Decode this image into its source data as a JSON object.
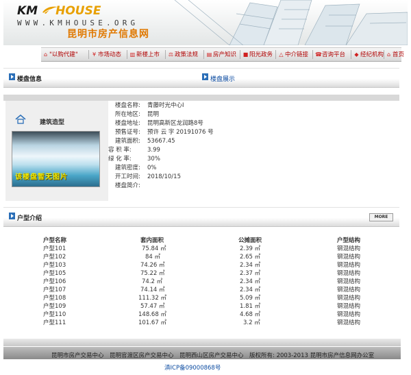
{
  "header": {
    "logo_km": "KM",
    "logo_house": "HOUSE",
    "url": "WWW.KMHOUSE.ORG",
    "site_name": "昆明市房产信息网"
  },
  "nav": {
    "items": [
      {
        "label": "\"以购代建\"",
        "icon": "house-icon"
      },
      {
        "label": "市场动态",
        "icon": "yuan-icon"
      },
      {
        "label": "新楼上市",
        "icon": "building-icon"
      },
      {
        "label": "政策法规",
        "icon": "scale-icon"
      },
      {
        "label": "房产知识",
        "icon": "book-icon"
      },
      {
        "label": "阳光政务",
        "icon": "sun-icon"
      },
      {
        "label": "中介链接",
        "icon": "link-icon"
      },
      {
        "label": "咨询平台",
        "icon": "phone-icon"
      },
      {
        "label": "经纪机构",
        "icon": "agency-icon"
      },
      {
        "label": "首页",
        "icon": "home-icon"
      }
    ]
  },
  "sections": {
    "info_title": "楼盘信息",
    "display_title": "楼盘展示",
    "unit_title": "户型介绍",
    "more": "MORE"
  },
  "building": {
    "label": "建筑造型",
    "photo_caption": "该楼盘暂无图片",
    "fields": [
      {
        "label": "楼盘名称:",
        "value": "青藤时光中心I"
      },
      {
        "label": "所在地区:",
        "value": "昆明"
      },
      {
        "label": "楼盘地址:",
        "value": "昆明高新区龙润路8号"
      },
      {
        "label": "预售证号:",
        "value": "预许 云 字 20191076 号"
      },
      {
        "label": "建筑面积:",
        "value": "53667.45"
      },
      {
        "label": "容 积 率:",
        "value": "3.99"
      },
      {
        "label": "绿 化 率:",
        "value": "30%"
      },
      {
        "label": "建筑密度:",
        "value": "0%"
      },
      {
        "label": "开工时间:",
        "value": "2018/10/15"
      },
      {
        "label": "楼盘简介:",
        "value": ""
      }
    ]
  },
  "units": {
    "headers": [
      "户型名称",
      "套内面积",
      "公摊面积",
      "户型结构"
    ],
    "rows": [
      {
        "name": "户型101",
        "inner": "75.84 ㎡",
        "shared": "2.39 ㎡",
        "structure": "钢混结构"
      },
      {
        "name": "户型102",
        "inner": "84 ㎡",
        "shared": "2.65 ㎡",
        "structure": "钢混结构"
      },
      {
        "name": "户型103",
        "inner": "74.26 ㎡",
        "shared": "2.34 ㎡",
        "structure": "钢混结构"
      },
      {
        "name": "户型105",
        "inner": "75.22 ㎡",
        "shared": "2.37 ㎡",
        "structure": "钢混结构"
      },
      {
        "name": "户型106",
        "inner": "74.2 ㎡",
        "shared": "2.34 ㎡",
        "structure": "钢混结构"
      },
      {
        "name": "户型107",
        "inner": "74.14 ㎡",
        "shared": "2.34 ㎡",
        "structure": "钢混结构"
      },
      {
        "name": "户型108",
        "inner": "111.32 ㎡",
        "shared": "5.09 ㎡",
        "structure": "钢混结构"
      },
      {
        "name": "户型109",
        "inner": "57.47 ㎡",
        "shared": "1.81 ㎡",
        "structure": "钢混结构"
      },
      {
        "name": "户型110",
        "inner": "148.68 ㎡",
        "shared": "4.68 ㎡",
        "structure": "钢混结构"
      },
      {
        "name": "户型111",
        "inner": "101.67 ㎡",
        "shared": "3.2 ㎡",
        "structure": "钢混结构"
      }
    ]
  },
  "footer": {
    "text": "昆明市房产交易中心　昆明官渡区房产交易中心　昆明西山区房产交易中心　版权所有: 2003-2013 昆明市房产信息网办公室",
    "icp": "滇ICP备09000868号"
  },
  "colors": {
    "accent_orange": "#e07800",
    "nav_red": "#b00000",
    "link_blue": "#0a4aa0"
  }
}
